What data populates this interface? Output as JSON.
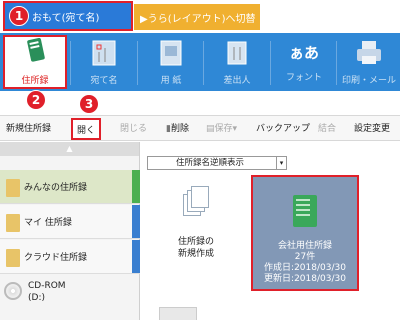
{
  "top_tabs": {
    "omote": "おもて(宛て名)",
    "ura": "▶うら(レイアウト)へ切替"
  },
  "badges": [
    "1",
    "2",
    "3"
  ],
  "ribbon": {
    "items": [
      {
        "label": "住所録",
        "icon": "address-book-icon"
      },
      {
        "label": "宛て名",
        "icon": "postcard-icon"
      },
      {
        "label": "用 紙",
        "icon": "paper-icon"
      },
      {
        "label": "差出人",
        "icon": "sender-icon"
      },
      {
        "label": "フォント",
        "icon": "font-icon",
        "glyph": "ぁあ"
      },
      {
        "label": "印刷・メール",
        "icon": "printer-icon"
      }
    ]
  },
  "toolbar": {
    "new": "新規住所録",
    "open": "開く",
    "close": "閉じる",
    "delete": "削除",
    "save": "保存",
    "backup": "バックアップ",
    "merge": "結合",
    "settings": "設定変更"
  },
  "left_panel": {
    "scroll_up": "▲",
    "books": [
      {
        "label": "みんなの住所録",
        "color": "#4caf50"
      },
      {
        "label": "マイ 住所録",
        "color": "#3a7fd0"
      },
      {
        "label": "クラウド住所録",
        "color": "#3a7fd0"
      }
    ],
    "cdrom_label": "CD-ROM",
    "cdrom_drive": "(D:)"
  },
  "main": {
    "sort_label": "住所録名逆順表示",
    "new_label_1": "住所録の",
    "new_label_2": "新規作成",
    "card": {
      "title": "会社用住所録",
      "count": "27件",
      "created": "作成日:2018/03/30",
      "updated": "更新日:2018/03/30"
    }
  }
}
